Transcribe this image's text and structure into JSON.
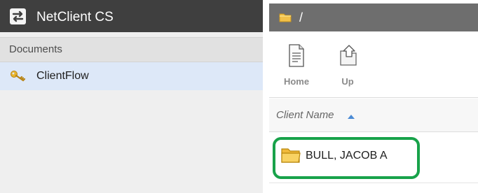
{
  "app": {
    "title": "NetClient CS",
    "logo_icon": "swap-arrows-icon"
  },
  "sidebar": {
    "section_label": "Documents",
    "items": [
      {
        "label": "ClientFlow",
        "icon": "key-icon",
        "selected": true
      }
    ]
  },
  "pathbar": {
    "path": "/",
    "icon": "folder-icon"
  },
  "toolbar": {
    "buttons": [
      {
        "label": "Home",
        "icon": "document-icon"
      },
      {
        "label": "Up",
        "icon": "folder-up-icon"
      }
    ]
  },
  "table": {
    "columns": [
      {
        "label": "Client Name",
        "sort": "ascending"
      }
    ],
    "rows": [
      {
        "name": "BULL, JACOB A",
        "icon": "folder-icon"
      }
    ]
  },
  "colors": {
    "header_bg": "#3f3f3f",
    "path_bar_bg": "#6e6e6e",
    "selection_bg": "#dde8f8",
    "highlight": "#18a24a",
    "sort_arrow": "#4b8bd5"
  }
}
